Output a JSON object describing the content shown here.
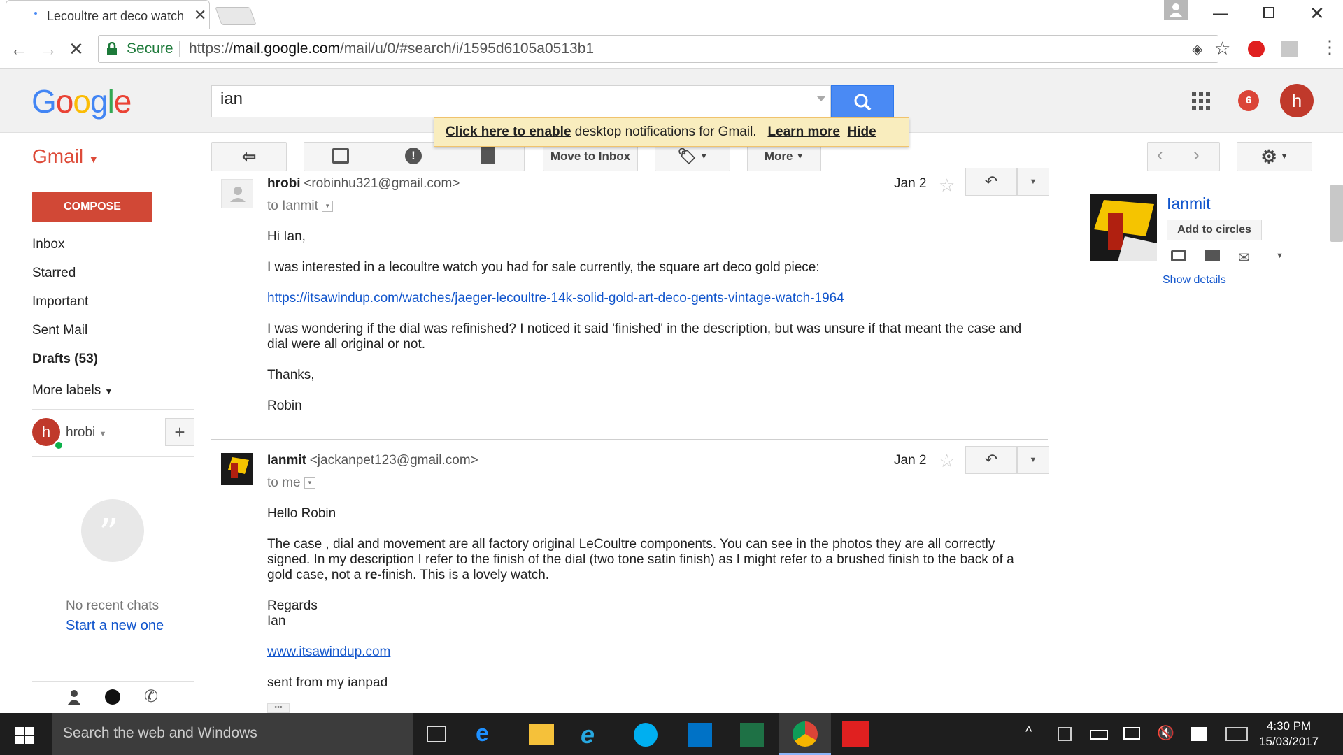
{
  "browser": {
    "tab_title": "Lecoultre art deco watch",
    "secure_label": "Secure",
    "url_scheme": "https://",
    "url_host": "mail.google.com",
    "url_path": "/mail/u/0/#search/i/1595d6105a0513b1"
  },
  "header": {
    "logo": "Google",
    "search_value": "ian",
    "notification_badge": "6",
    "avatar_letter": "h"
  },
  "notification": {
    "link": "Click here to enable",
    "text": " desktop notifications for Gmail.",
    "learn_more": "Learn more",
    "hide": "Hide"
  },
  "toolbar": {
    "app_label": "Gmail",
    "move_to_inbox": "Move to Inbox",
    "more": "More"
  },
  "sidebar": {
    "compose": "COMPOSE",
    "items": [
      {
        "label": "Inbox"
      },
      {
        "label": "Starred"
      },
      {
        "label": "Important"
      },
      {
        "label": "Sent Mail"
      },
      {
        "label": "Drafts (53)"
      }
    ],
    "more_labels": "More labels",
    "user_name": "hrobi",
    "user_letter": "h",
    "no_chats": "No recent chats",
    "start_chat": "Start a new one"
  },
  "messages": [
    {
      "sender": "hrobi",
      "email": "<robinhu321@gmail.com>",
      "date": "Jan 2",
      "to": "to Ianmit",
      "body": [
        "Hi Ian,",
        "I was interested in a lecoultre watch you had for sale currently, the square art deco gold piece:",
        "https://itsawindup.com/watches/jaeger-lecoultre-14k-solid-gold-art-deco-gents-vintage-watch-1964",
        "I was wondering if the dial was refinished? I noticed it said 'finished' in the description, but was unsure if that meant the case and",
        "dial were all original or not.",
        "Thanks,",
        "Robin"
      ]
    },
    {
      "sender": "Ianmit",
      "email": "<jackanpet123@gmail.com>",
      "date": "Jan 2",
      "to": "to me",
      "body": [
        "Hello Robin",
        "The case , dial and movement are all factory original LeCoultre components.  You can see in the photos they are all correctly",
        "signed. In my description I refer to the finish of the dial (two tone satin finish) as I might refer to a brushed finish to the back of a",
        "gold case, not a ",
        "re-",
        "finish. This is a lovely watch.",
        "Regards",
        "Ian",
        "www.itsawindup.com",
        "sent from my ianpad"
      ]
    }
  ],
  "contact_card": {
    "name": "Ianmit",
    "add_to_circles": "Add to circles",
    "show_details": "Show details"
  },
  "taskbar": {
    "search_placeholder": "Search the web and Windows",
    "time": "4:30 PM",
    "date": "15/03/2017"
  },
  "colors": {
    "gmail_red": "#dd4b39",
    "compose_red": "#d14836",
    "search_blue": "#4a8af4",
    "link_blue": "#1155cc",
    "notif_yellow": "#f9edbe"
  }
}
